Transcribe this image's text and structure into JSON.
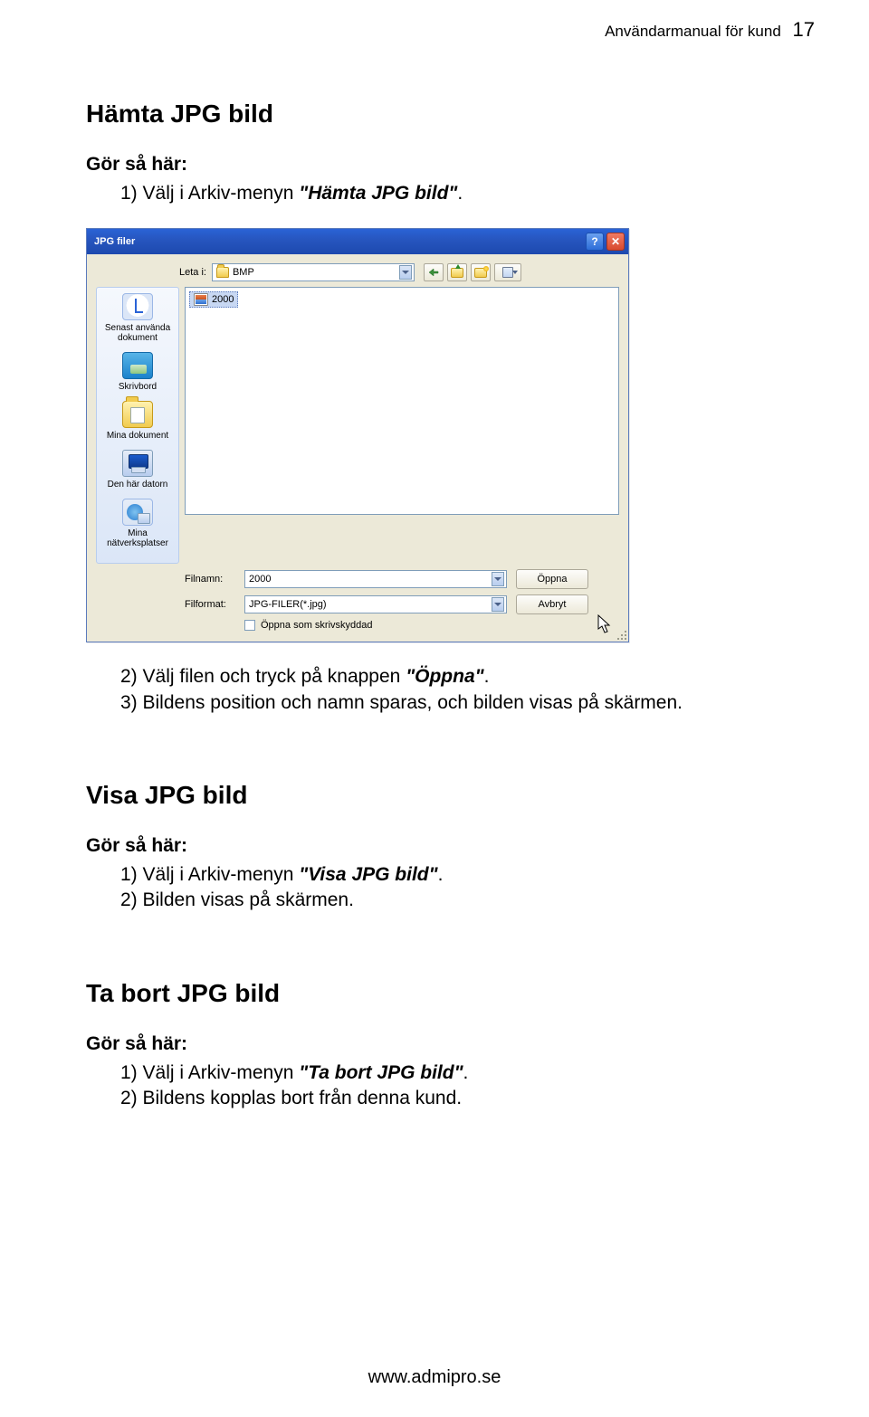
{
  "header": {
    "doc_title": "Användarmanual för kund",
    "page_number": "17"
  },
  "section1": {
    "heading": "Hämta JPG bild",
    "subheading": "Gör så här:",
    "steps": {
      "s1_pre": "1) Välj i Arkiv-menyn ",
      "s1_em": "\"Hämta JPG bild\"",
      "s1_post": ".",
      "s2_pre": "2) Välj filen och tryck på knappen ",
      "s2_em": "\"Öppna\"",
      "s2_post": ".",
      "s3": "3) Bildens position och namn sparas, och bilden visas på skärmen."
    }
  },
  "dialog": {
    "title": "JPG filer",
    "look_in_label": "Leta i:",
    "look_in_value": "BMP",
    "sidebar": {
      "recent": "Senast använda dokument",
      "desktop": "Skrivbord",
      "documents": "Mina dokument",
      "computer": "Den här datorn",
      "network": "Mina nätverksplatser"
    },
    "file_list": {
      "item1": "2000"
    },
    "filename_label": "Filnamn:",
    "filename_value": "2000",
    "filetype_label": "Filformat:",
    "filetype_value": "JPG-FILER(*.jpg)",
    "readonly_label": "Öppna som skrivskyddad",
    "open_btn": "Öppna",
    "cancel_btn": "Avbryt"
  },
  "section2": {
    "heading": "Visa JPG bild",
    "subheading": "Gör så här:",
    "steps": {
      "s1_pre": "1) Välj i Arkiv-menyn  ",
      "s1_em": "\"Visa JPG bild\"",
      "s1_post": ".",
      "s2": "2) Bilden visas på skärmen."
    }
  },
  "section3": {
    "heading": "Ta bort JPG bild",
    "subheading": "Gör så här:",
    "steps": {
      "s1_pre": "1) Välj i Arkiv-menyn ",
      "s1_em": "\"Ta bort JPG bild\"",
      "s1_post": ".",
      "s2": "2) Bildens kopplas bort från denna kund."
    }
  },
  "footer": {
    "url": "www.admipro.se"
  }
}
